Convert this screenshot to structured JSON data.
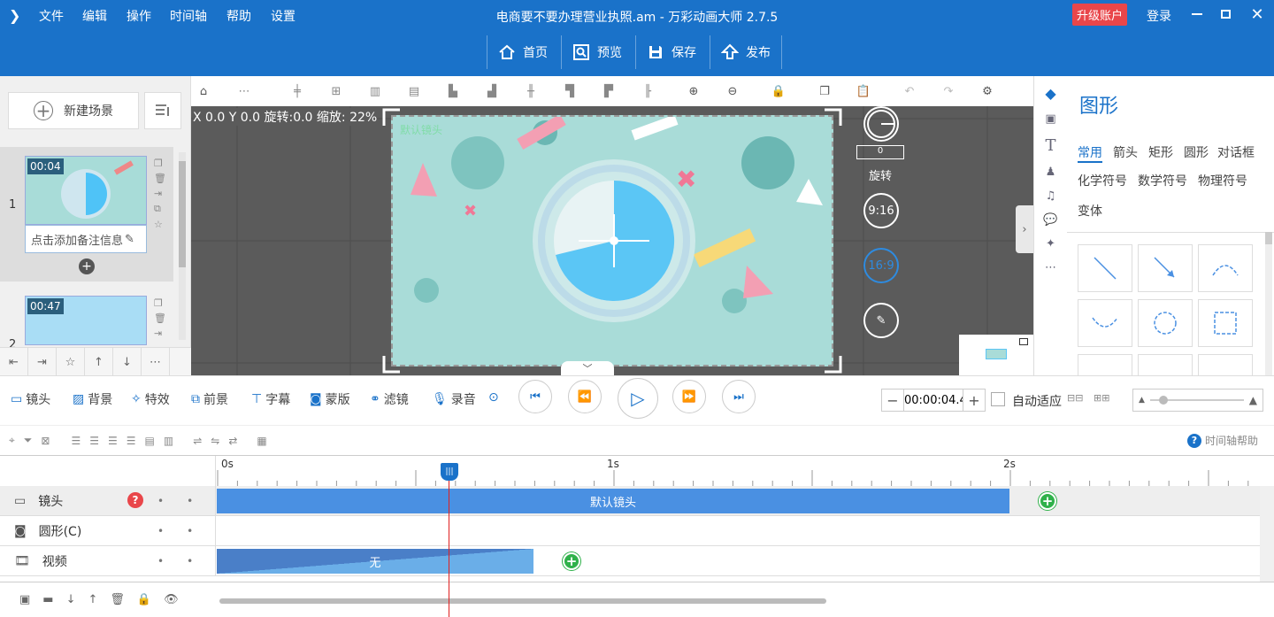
{
  "titlebar": {
    "menus": [
      "文件",
      "编辑",
      "操作",
      "时间轴",
      "帮助",
      "设置"
    ],
    "title": "电商要不要办理营业执照.am - 万彩动画大师 2.7.5",
    "actions": [
      "首页",
      "预览",
      "保存",
      "发布"
    ],
    "upgrade": "升级账户",
    "login": "登录"
  },
  "left": {
    "new_scene": "新建场景",
    "scenes": [
      {
        "index": "1",
        "duration": "00:04",
        "note": "点击添加备注信息"
      },
      {
        "index": "2",
        "duration": "00:47",
        "note": ""
      }
    ]
  },
  "canvas": {
    "coords": "X 0.0 Y 0.0 旋转:0.0 缩放: 22%",
    "camera_label": "默认镜头",
    "rotate_value": "0",
    "rotate_label": "旋转",
    "ratio_a": "9:16",
    "ratio_b": "16:9"
  },
  "right": {
    "title": "图形",
    "categories": [
      "常用",
      "箭头",
      "矩形",
      "圆形",
      "对话框",
      "化学符号",
      "数学符号",
      "物理符号",
      "变体"
    ]
  },
  "layers": [
    "镜头",
    "背景",
    "特效",
    "前景",
    "字幕",
    "蒙版",
    "滤镜",
    "录音"
  ],
  "time": {
    "value": "00:00:04.4",
    "auto_fit": "自动适应"
  },
  "timeline": {
    "help": "时间轴帮助",
    "ticks": [
      "0s",
      "1s",
      "2s"
    ],
    "tracks": [
      {
        "name": "镜头",
        "bar": "默认镜头"
      },
      {
        "name": "圆形(C)",
        "bar": ""
      },
      {
        "name": "视频",
        "bar": "无"
      }
    ]
  },
  "colors": {
    "accent": "#1a72c9",
    "track_bar": "#4a90e2",
    "keyframe": "#2fb14a"
  }
}
